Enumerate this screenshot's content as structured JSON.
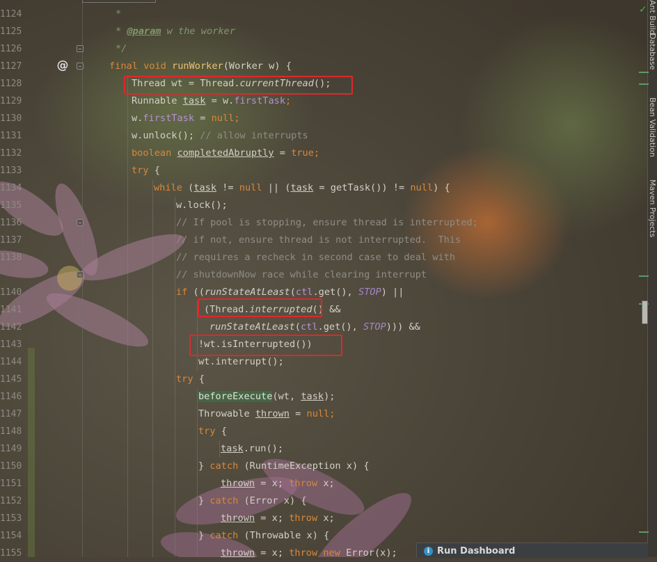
{
  "line_numbers": [
    "1124",
    "1125",
    "1126",
    "1127",
    "1128",
    "1129",
    "1130",
    "1131",
    "1132",
    "1133",
    "1134",
    "1135",
    "1136",
    "1137",
    "1138",
    "1140",
    "1141",
    "1142",
    "1143",
    "1144",
    "1145",
    "1146",
    "1147",
    "1148",
    "1149",
    "1150",
    "1151",
    "1152",
    "1153",
    "1154",
    "1155"
  ],
  "code": {
    "l1124": {
      "star": "*"
    },
    "l1125": {
      "star": "* ",
      "tag": "@param",
      "text": " w the worker"
    },
    "l1126": {
      "end": "*/"
    },
    "l1127": {
      "kw": "final void ",
      "name": "runWorker",
      "rest": "(Worker w) {"
    },
    "l1128": {
      "a": "Thread wt = Thread.",
      "b": "currentThread",
      "c": "();"
    },
    "l1129": {
      "a": "Runnable ",
      "b": "task",
      "c": " = w.",
      "d": "firstTask",
      "e": ";"
    },
    "l1130": {
      "a": "w.",
      "b": "firstTask",
      "c": " = ",
      "d": "null",
      "e": ";"
    },
    "l1131": {
      "a": "w.unlock(); ",
      "b": "// allow interrupts"
    },
    "l1132": {
      "a": "boolean ",
      "b": "completedAbruptly",
      "c": " = ",
      "d": "true",
      "e": ";"
    },
    "l1133": {
      "a": "try",
      "b": " {"
    },
    "l1134": {
      "a": "while",
      "b": " (",
      "c": "task",
      "d": " != ",
      "e": "null",
      "f": " || (",
      "g": "task",
      "h": " = getTask()) != ",
      "i": "null",
      "j": ") {"
    },
    "l1135": {
      "a": "w.lock();"
    },
    "l1136": {
      "a": "// If pool is stopping, ensure thread is interrupted;"
    },
    "l1137": {
      "a": "// if not, ensure thread is not interrupted.  This"
    },
    "l1138": {
      "a": "// requires a recheck in second case to deal with"
    },
    "l1139": {
      "a": "// shutdownNow race while clearing interrupt"
    },
    "l1140": {
      "a": "if",
      "b": " ((",
      "c": "runStateAtLeast",
      "d": "(",
      "e": "ctl",
      "f": ".get(), ",
      "g": "STOP",
      "h": ") ||"
    },
    "l1141": {
      "a": "(Thread.",
      "b": "interrupted",
      "c": "()",
      "d": " &&"
    },
    "l1142": {
      "a": "runStateAtLeast",
      "b": "(",
      "c": "ctl",
      "d": ".get(), ",
      "e": "STOP",
      "f": "))) &&"
    },
    "l1143": {
      "a": "!wt.isInterrupted())"
    },
    "l1144": {
      "a": "wt.interrupt();"
    },
    "l1145": {
      "a": "try",
      "b": " {"
    },
    "l1146": {
      "a": "beforeExecute",
      "b": "(wt, ",
      "c": "task",
      "d": ");"
    },
    "l1147": {
      "a": "Throwable ",
      "b": "thrown",
      "c": " = ",
      "d": "null",
      "e": ";"
    },
    "l1148": {
      "a": "try",
      "b": " {"
    },
    "l1149": {
      "a": "task",
      "b": ".run();"
    },
    "l1150": {
      "a": "} ",
      "b": "catch",
      "c": " (RuntimeException x) {"
    },
    "l1151": {
      "a": "thrown",
      "b": " = x; ",
      "c": "throw",
      "d": " x;"
    },
    "l1152": {
      "a": "} ",
      "b": "catch",
      "c": " (Error x) {"
    },
    "l1153": {
      "a": "thrown",
      "b": " = x; ",
      "c": "throw",
      "d": " x;"
    },
    "l1154": {
      "a": "} ",
      "b": "catch",
      "c": " (Throwable x) {"
    },
    "l1155": {
      "a": "thrown",
      "b": " = x; ",
      "c": "throw new",
      "d": " Error(x);"
    }
  },
  "side_tabs": {
    "database": "Database",
    "bean_validation": "Bean Validation",
    "maven_projects": "Maven Projects",
    "first": "Ant Build"
  },
  "run_dashboard": {
    "label": "Run Dashboard",
    "icon": "info-icon"
  },
  "colors": {
    "keyword": "#d9883a",
    "field": "#b98fd6",
    "comment": "#8e8d86",
    "doc": "#7f9a6a",
    "highlight_box": "#e0272b"
  }
}
